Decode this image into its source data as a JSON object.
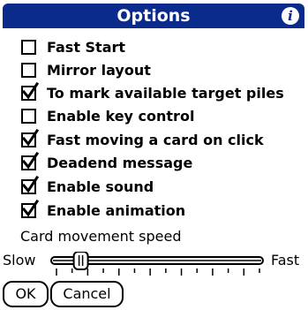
{
  "dialog": {
    "title": "Options",
    "info_icon": "info-icon",
    "title_bar_color": "#0a2a8c"
  },
  "options": [
    {
      "label": "Fast Start",
      "checked": false
    },
    {
      "label": "Mirror layout",
      "checked": false
    },
    {
      "label": "To mark available target piles",
      "checked": true
    },
    {
      "label": "Enable key control",
      "checked": false
    },
    {
      "label": "Fast moving a card on click",
      "checked": true
    },
    {
      "label": "Deadend message",
      "checked": true
    },
    {
      "label": "Enable sound",
      "checked": true
    },
    {
      "label": "Enable animation",
      "checked": true
    }
  ],
  "speed": {
    "label": "Card movement speed",
    "min_label": "Slow",
    "max_label": "Fast",
    "value_fraction": 0.12,
    "tick_count": 14
  },
  "buttons": {
    "ok": "OK",
    "cancel": "Cancel"
  }
}
